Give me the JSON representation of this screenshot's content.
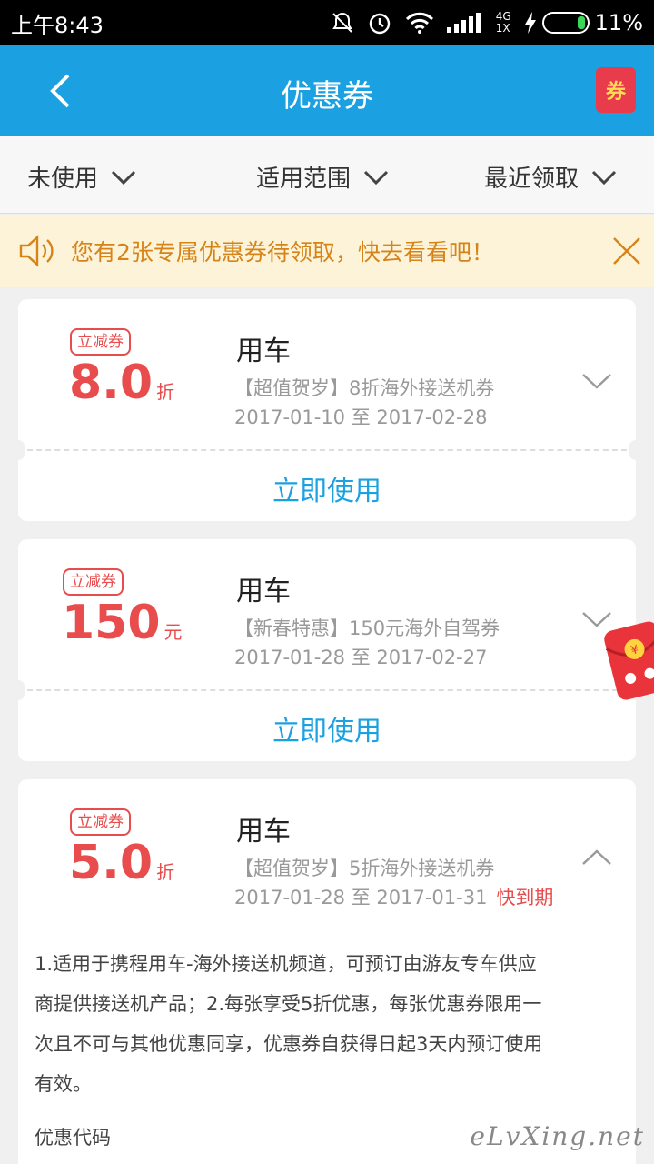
{
  "status_bar": {
    "time": "上午8:43",
    "network": "4G",
    "sim": "1X",
    "battery": "11%",
    "battery_level": 0.11,
    "icons": [
      "notifications-off-icon",
      "alarm-icon",
      "wifi-icon",
      "signal-icon",
      "charging-icon",
      "battery-icon"
    ]
  },
  "header": {
    "title": "优惠券",
    "back_icon": "chevron-left-icon",
    "coupon_icon_text": "券",
    "colors": {
      "bar": "#1ba1e2",
      "coupon_badge": "#e83c4c"
    }
  },
  "filters": [
    {
      "label": "未使用",
      "icon": "chevron-down-icon"
    },
    {
      "label": "适用范围",
      "icon": "chevron-down-icon"
    },
    {
      "label": "最近领取",
      "icon": "chevron-down-icon"
    }
  ],
  "notice": {
    "text": "您有2张专属优惠券待领取，快去看看吧！",
    "icon": "speaker-icon",
    "close_icon": "close-icon"
  },
  "coupons": [
    {
      "tag": "立减券",
      "amount": "8.0",
      "unit": "折",
      "category": "用车",
      "description": "【超值贺岁】8折海外接送机券",
      "date_range": "2017-01-10 至 2017-02-28",
      "action": "立即使用",
      "toggle_icon": "chevron-down-icon"
    },
    {
      "tag": "立减券",
      "amount": "150",
      "unit": "元",
      "category": "用车",
      "description": "【新春特惠】150元海外自驾券",
      "date_range": "2017-01-28 至 2017-02-27",
      "action": "立即使用",
      "toggle_icon": "chevron-down-icon"
    },
    {
      "tag": "立减券",
      "amount": "5.0",
      "unit": "折",
      "category": "用车",
      "description": "【超值贺岁】5折海外接送机券",
      "date_range": "2017-01-28 至 2017-01-31",
      "status": "快到期",
      "toggle_icon": "chevron-up-icon",
      "details": "1.适用于携程用车-海外接送机频道，可预订由游友专车供应商提供接送机产品；2.每张享受5折优惠，每张优惠券限用一次且不可与其他优惠同享，优惠券自获得日起3天内预订使用有效。",
      "details_lines": [
        "1.适用于携程用车-海外接送机频道，可预订由游友专车供应",
        "商提供接送机产品；2.每张享受5折优惠，每张优惠券限用一",
        "次且不可与其他优惠同享，优惠券自获得日起3天内预订使用",
        "有效。"
      ],
      "promo_code_label": "优惠代码"
    }
  ],
  "floating": {
    "icon": "red-envelope-icon"
  },
  "watermark": "eLvXing.net",
  "colors": {
    "accent": "#1ba1e2",
    "red": "#e84c4c",
    "notice_bg": "#fdf3d9",
    "notice_text": "#d68417"
  }
}
